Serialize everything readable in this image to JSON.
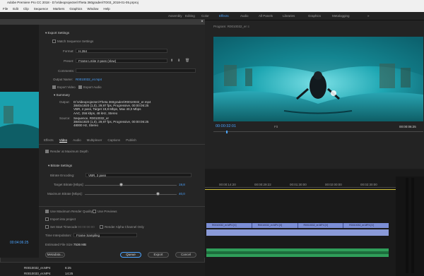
{
  "window": {
    "title": "Adobe Premiere Pro CC 2018 - D:\\Videoprojecten\\Theta 360graden\\TO03_2018-01-05.prproj"
  },
  "menu": [
    "File",
    "Edit",
    "Clip",
    "Sequence",
    "Markers",
    "Graphics",
    "Window",
    "Help"
  ],
  "workspaces": [
    "Assembly",
    "Editing",
    "Color",
    "Effects",
    "Audio",
    "All Panels",
    "Libraries",
    "Graphics",
    "Metalogging"
  ],
  "active_workspace": "Effects",
  "program": {
    "header": "Program: R0010032_er ≡",
    "timecode_in": "00:00:32:01",
    "timecode_out": "00:00:06:25",
    "fit": "Fit"
  },
  "export": {
    "export_settings_header": "Export Settings",
    "match_sequence": "Match Sequence Settings",
    "format_label": "Format:",
    "format_value": "H.264",
    "preset_label": "Preset:",
    "preset_value": "Frame Lmite 2-pass (slow)",
    "comments_label": "Comments:",
    "output_label": "Output Name:",
    "output_value": "R0010032_er.mp4",
    "export_video": "Export Video",
    "export_audio": "Export Audio",
    "summary_header": "Summary",
    "output_summary_label": "Output:",
    "output_summary": [
      "D:\\Videoprojecten\\Theta 360graden\\R0010032_er.mp4",
      "3840x1920 (1,0), 29,97 fps, Progressive, 00:00:06:25",
      "VBR, 2 pass, Target 19,8 Mbps, Max 40,0 Mbps",
      "AAC, 256 kbps, 48 kHz, Stereo"
    ],
    "source_summary_label": "Source:",
    "source_summary": [
      "Sequence, R0010032_er",
      "3840x1920 (1,0), 29,97 fps, Progressive, 00:00:06:25",
      "48000 Hz, Stereo"
    ],
    "tabs": [
      "Effects",
      "Video",
      "Audio",
      "Multiplexer",
      "Captions",
      "Publish"
    ],
    "active_tab": "Video",
    "render_max_depth": "Render at Maximum Depth",
    "bitrate_header": "Bitrate Settings",
    "bitrate_encoding_label": "Bitrate Encoding:",
    "bitrate_encoding_value": "VBR, 2 pass",
    "target_bitrate_label": "Target Bitrate [Mbps]:",
    "target_bitrate_value": "19,8",
    "max_bitrate_label": "Maximum Bitrate [Mbps]:",
    "max_bitrate_value": "40,0",
    "target_bitrate_fraction": 0.4,
    "max_bitrate_fraction": 0.8,
    "use_max_render": "Use Maximum Render Quality",
    "use_previews": "Use Previews",
    "import_project": "Import into project",
    "set_start_timecode": "Set Start Timecode",
    "start_timecode_value": "00:00:00:00",
    "render_alpha": "Render Alpha Channel Only",
    "time_interp_label": "Time Interpolation:",
    "time_interp_value": "Frame Sampling",
    "est_size_label": "Estimated File Size:",
    "est_size_value": "7536 MB",
    "metadata_btn": "Metadata...",
    "queue_btn": "Queue",
    "export_btn": "Export",
    "cancel_btn": "Cancel"
  },
  "source": {
    "timecode": "00:04:06:25"
  },
  "project": {
    "items": [
      {
        "name": "R0010032_er.MP4",
        "duration": "6:25"
      },
      {
        "name": "R0010033_er.MP4",
        "duration": "14:25"
      }
    ]
  },
  "timeline": {
    "ticks": [
      "00:00:14:20",
      "00:00:29:22",
      "00:01:30:00",
      "00:02:00:00",
      "00:02:30:00"
    ],
    "clips": [
      "R0010032_er.MP4 [V]",
      "R0010032_er.MP4 [V]",
      "R0010032_er.MP4 [V]",
      "R0010032_er.MP4 [V]"
    ]
  },
  "colors": {
    "accent": "#4aa3ff",
    "clip_video": "#7b8ed6",
    "clip_audio": "#2f9e5a"
  }
}
